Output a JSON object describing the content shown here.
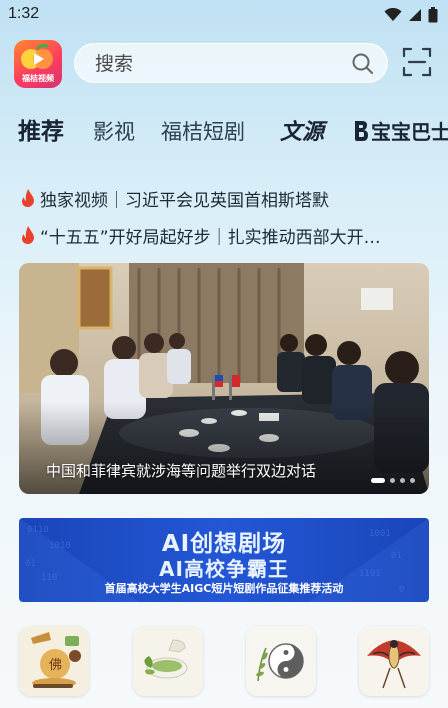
{
  "status_bar": {
    "time": "1:32"
  },
  "app": {
    "logo_text": "福桔视频"
  },
  "search": {
    "placeholder": "搜索"
  },
  "tabs": [
    {
      "label": "推荐",
      "active": true
    },
    {
      "label": "影视"
    },
    {
      "label": "福桔短剧"
    },
    {
      "label": "文源"
    },
    {
      "label": "宝宝巴士"
    }
  ],
  "headlines": [
    {
      "text": "独家视频｜习近平会见英国首相斯塔默"
    },
    {
      "text": "“十五五”开好局起好步｜扎实推动西部大开…"
    }
  ],
  "banner": {
    "caption": "中国和菲律宾就涉海等问题举行双边对话",
    "slide_count": 4,
    "active_slide": 1
  },
  "promo": {
    "title_line1": "AI创想剧场",
    "title_line2": "AI高校争霸王",
    "subtitle": "首届高校大学生AIGC短片短剧作品征集推荐活动"
  },
  "categories": [
    {
      "icon": "buddha-tea-icon"
    },
    {
      "icon": "tea-cup-icon"
    },
    {
      "icon": "taiji-icon"
    },
    {
      "icon": "kite-icon"
    }
  ],
  "colors": {
    "accent": "#1a2533",
    "flame": "#e8412c",
    "promo_blue": "#2357d6",
    "logo_orange": "#ff8a2b",
    "logo_red": "#ff3d5f"
  }
}
